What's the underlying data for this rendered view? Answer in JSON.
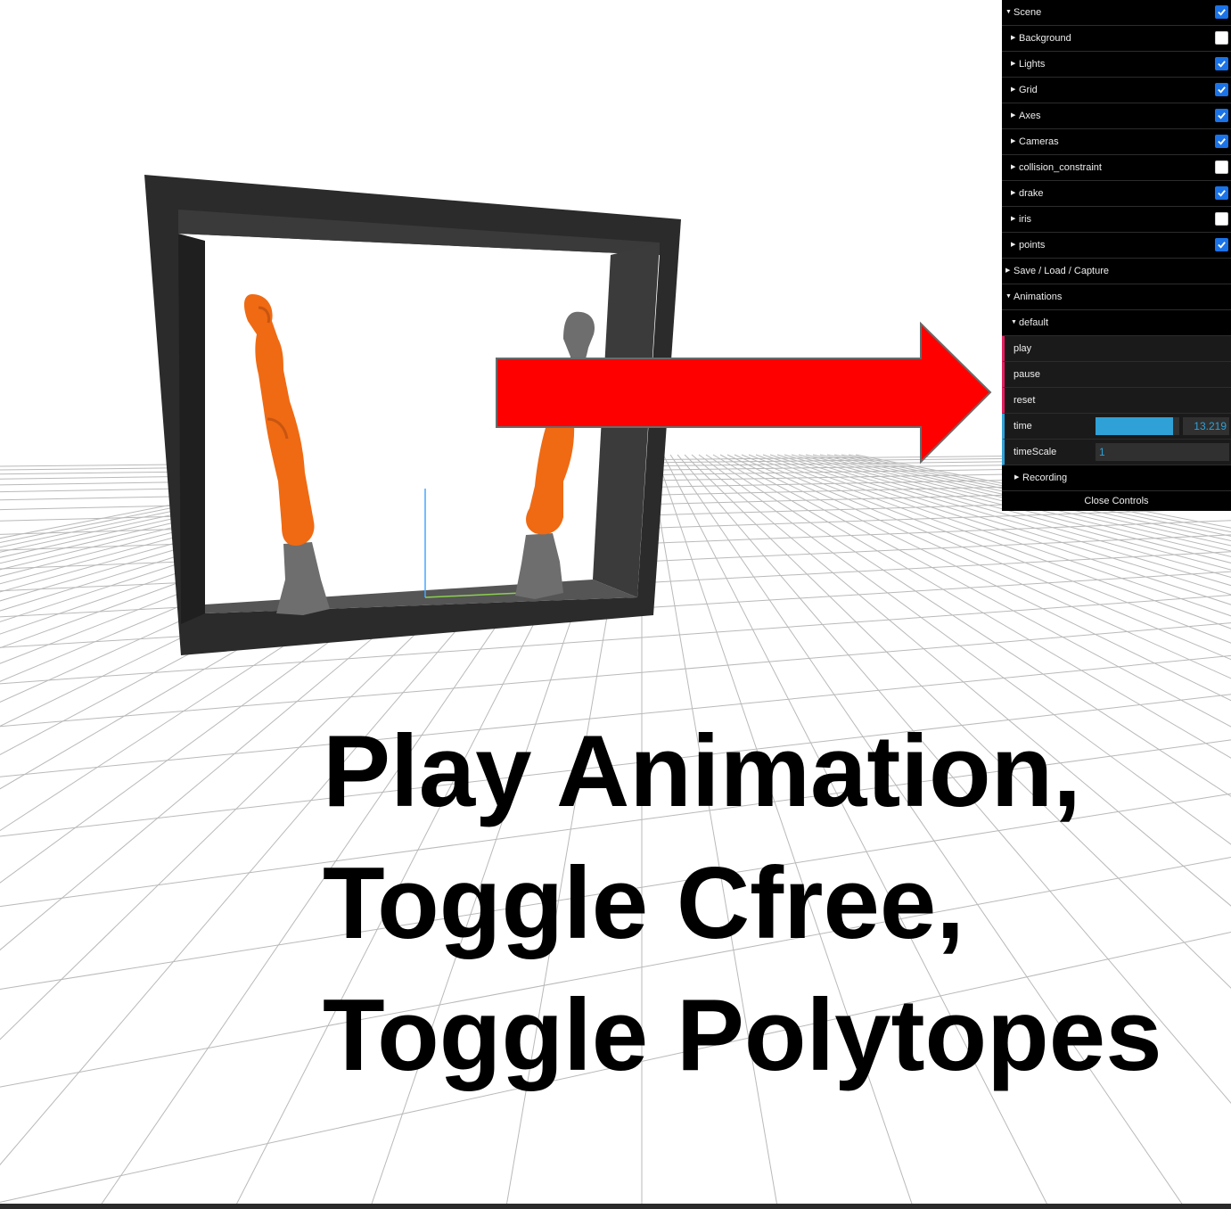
{
  "caption": {
    "line1": "Play Animation,",
    "line2": "Toggle Cfree,",
    "line3": "Toggle Polytopes"
  },
  "colors": {
    "arrow": "#ff0000",
    "robot_orange": "#ef6a13",
    "robot_gray": "#6e6e6e",
    "frame": "#2b2b2b",
    "panel_bg": "#000000",
    "accent_blue": "#2fa1d6",
    "function_pink": "#e61d5f",
    "checkbox_blue": "#1a73e8"
  },
  "controls": {
    "scene": {
      "label": "Scene",
      "checked": true
    },
    "items": [
      {
        "label": "Background",
        "checked": false
      },
      {
        "label": "Lights",
        "checked": true
      },
      {
        "label": "Grid",
        "checked": true
      },
      {
        "label": "Axes",
        "checked": true
      },
      {
        "label": "Cameras",
        "checked": true
      },
      {
        "label": "collision_constraint",
        "checked": false
      },
      {
        "label": "drake",
        "checked": true
      },
      {
        "label": "iris",
        "checked": false
      },
      {
        "label": "points",
        "checked": true
      }
    ],
    "save_load": "Save / Load / Capture",
    "animations": "Animations",
    "default": "default",
    "play": "play",
    "pause": "pause",
    "reset": "reset",
    "time_label": "time",
    "time_value": "13.219",
    "time_fraction": 0.93,
    "timescale_label": "timeScale",
    "timescale_value": "1",
    "recording": "Recording",
    "close": "Close Controls"
  }
}
